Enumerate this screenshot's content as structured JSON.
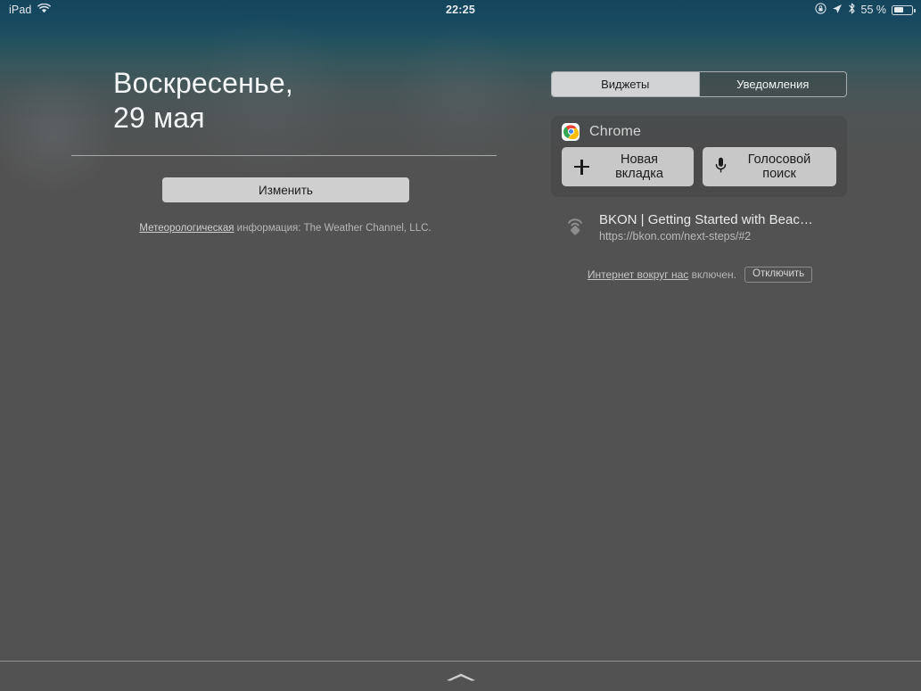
{
  "statusbar": {
    "device": "iPad",
    "wifi_icon": "wifi-icon",
    "time": "22:25",
    "rotation_lock_icon": "rotation-lock-icon",
    "location_icon": "location-arrow-icon",
    "bluetooth_icon": "bluetooth-icon",
    "battery_percent": "55 %",
    "battery_icon": "battery-icon"
  },
  "today": {
    "date_weekday": "Воскресенье,",
    "date_day_month": "29 мая",
    "edit_label": "Изменить",
    "weather_credit_link": "Метеорологическая",
    "weather_credit_rest": " информация: The Weather Channel, LLC."
  },
  "panel": {
    "tabs": [
      {
        "label": "Виджеты",
        "selected": true
      },
      {
        "label": "Уведомления",
        "selected": false
      }
    ],
    "widget": {
      "icon": "chrome-icon",
      "title": "Chrome",
      "actions": [
        {
          "label": "Новая вкладка",
          "icon": "plus-icon"
        },
        {
          "label": "Голосовой поиск",
          "icon": "microphone-icon"
        }
      ]
    },
    "beacon": {
      "icon": "beacon-icon",
      "title": "BKON | Getting Started with Beac…",
      "url": "https://bkon.com/next-steps/#2"
    },
    "footer": {
      "link": "Интернет вокруг нас",
      "text": " включен.",
      "disable_label": "Отключить"
    }
  },
  "bottom": {
    "grabber_icon": "grabber-handle-icon"
  },
  "colors": {
    "background": "#525252",
    "statusbar": "#14455d",
    "button_light": "#c8c8c8",
    "segment_selected": "#d2d3d4"
  }
}
